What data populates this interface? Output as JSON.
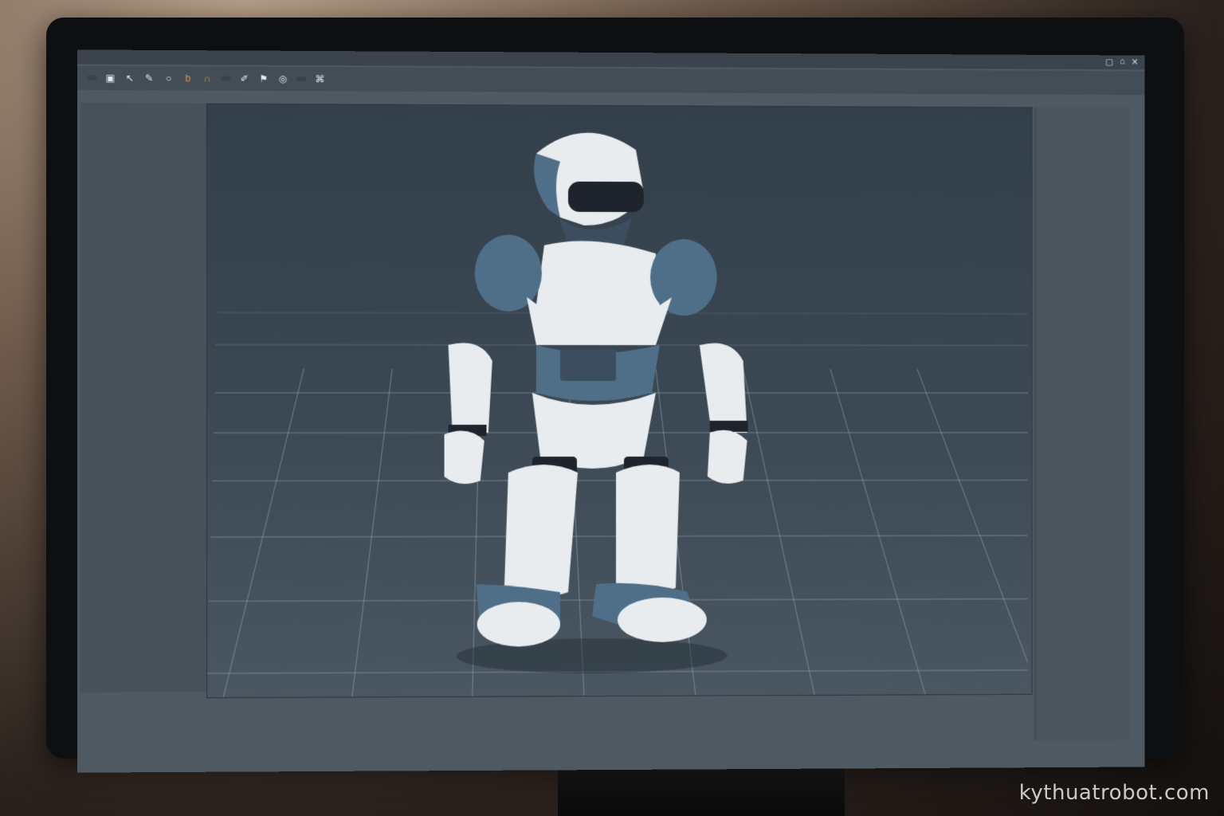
{
  "window": {
    "title": "",
    "left_icons": "",
    "controls": [
      "▢",
      "⌂",
      "✕"
    ]
  },
  "toolbar": {
    "buttons": [
      "",
      "",
      ""
    ],
    "icons": [
      "cube-icon",
      "pointer-icon",
      "pen-icon",
      "circle-icon",
      "hand-icon",
      "magnet-icon",
      "brush-icon",
      "flag-icon",
      "orbit-icon",
      "render-icon"
    ]
  },
  "status_text": "",
  "left_panel": {
    "items": [
      "",
      "",
      "",
      "",
      "",
      "",
      "",
      "",
      "",
      "",
      ""
    ]
  },
  "right_panel": {
    "labels": [
      "",
      "",
      "",
      "",
      "",
      "",
      "",
      "",
      "",
      "",
      "",
      ""
    ]
  },
  "bottom_status": "",
  "watermark": "kythuatrobot.com",
  "colors": {
    "robot_white": "#e8ecef",
    "robot_blue": "#4f6f89",
    "viewport": "#3a4651",
    "panel": "#46515a"
  }
}
